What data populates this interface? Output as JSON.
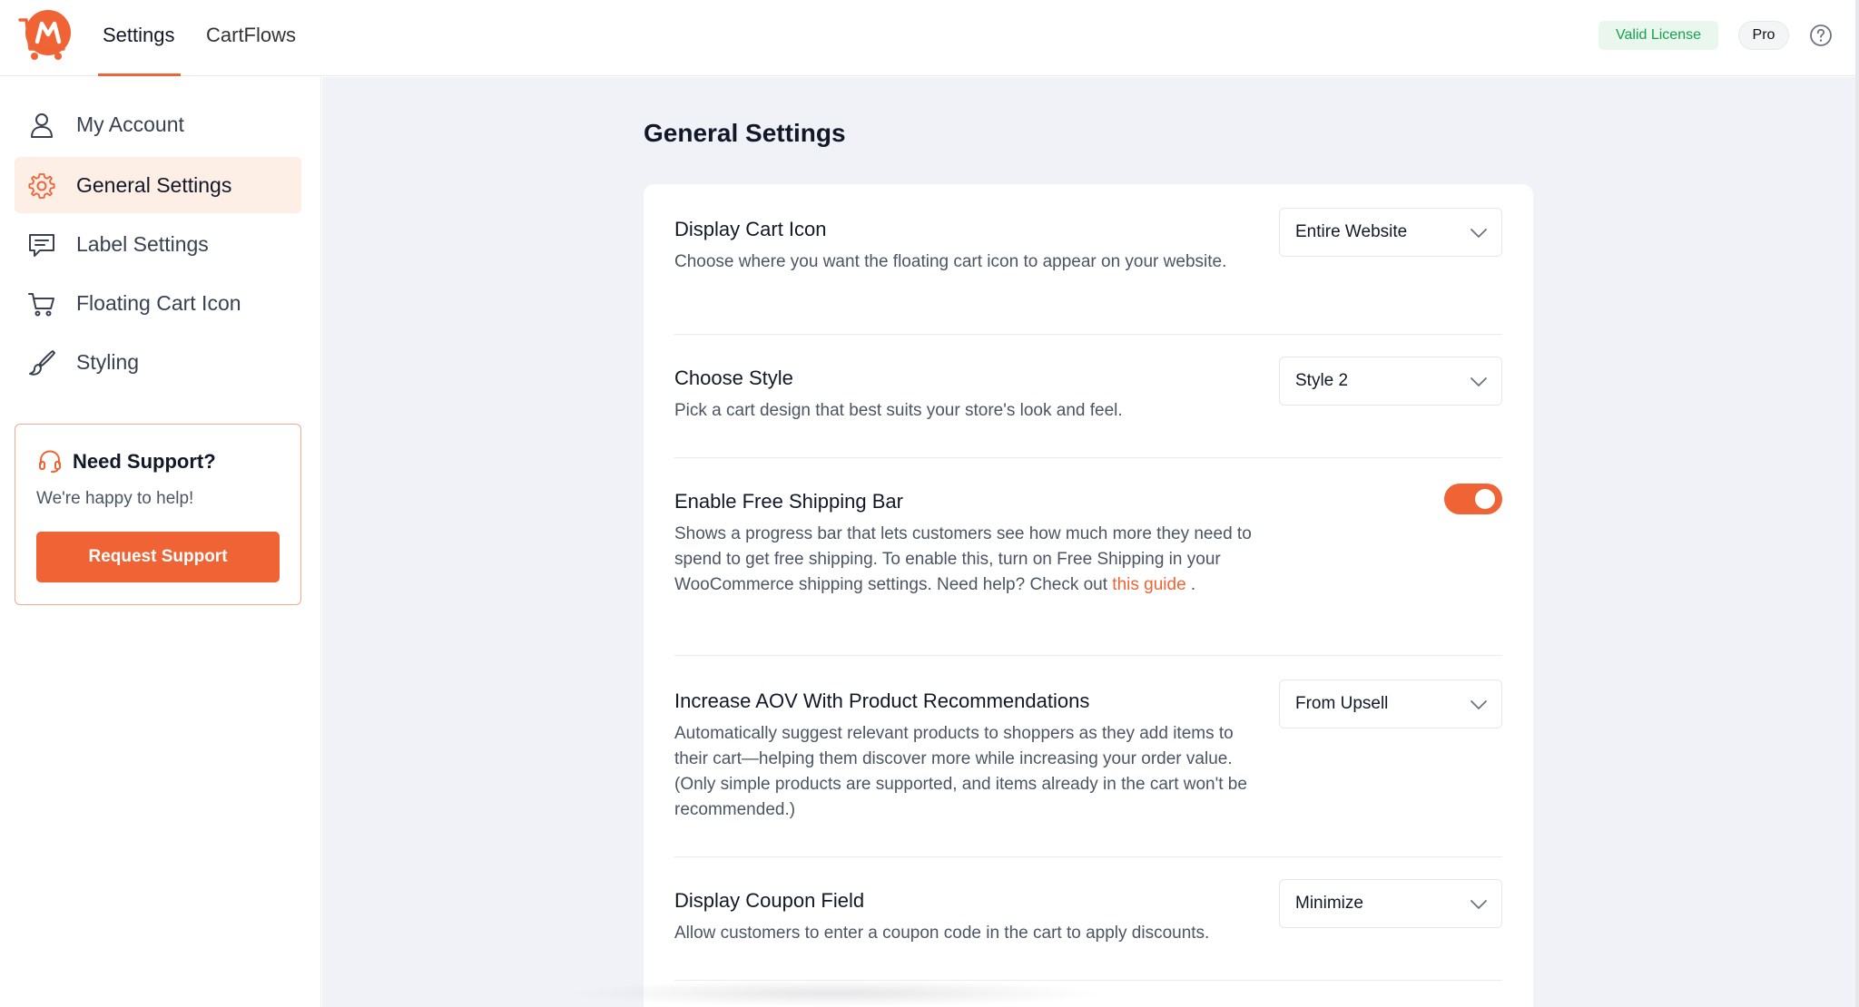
{
  "header": {
    "tabs": [
      {
        "label": "Settings",
        "active": true
      },
      {
        "label": "CartFlows",
        "active": false
      }
    ],
    "license_badge": "Valid License",
    "plan_badge": "Pro",
    "icons": {
      "logo": "cart-logo-icon",
      "help": "help-circle-icon"
    }
  },
  "sidebar": {
    "items": [
      {
        "label": "My Account",
        "icon": "user-icon",
        "active": false
      },
      {
        "label": "General Settings",
        "icon": "gear-icon",
        "active": true
      },
      {
        "label": "Label Settings",
        "icon": "message-icon",
        "active": false
      },
      {
        "label": "Floating Cart Icon",
        "icon": "cart-icon",
        "active": false
      },
      {
        "label": "Styling",
        "icon": "brush-icon",
        "active": false
      }
    ],
    "support": {
      "title": "Need Support?",
      "subtitle": "We're happy to help!",
      "button": "Request Support",
      "icon": "headset-icon"
    }
  },
  "main": {
    "title": "General Settings",
    "settings": [
      {
        "title": "Display Cart Icon",
        "description": "Choose where you want the floating cart icon to appear on your website.",
        "control": "select",
        "value": "Entire Website"
      },
      {
        "title": "Choose Style",
        "description": "Pick a cart design that best suits your store's look and feel.",
        "control": "select",
        "value": "Style 2"
      },
      {
        "title": "Enable Free Shipping Bar",
        "description_before": "Shows a progress bar that lets customers see how much more they need to spend to get free shipping. To enable this, turn on Free Shipping in your WooCommerce shipping settings. Need help? Check out ",
        "link": "this guide",
        "description_after": " .",
        "control": "toggle",
        "enabled": true
      },
      {
        "title": "Increase AOV With Product Recommendations",
        "description": "Automatically suggest relevant products to shoppers as they add items to their cart—helping them discover more while increasing your order value. (Only simple products are supported, and items already in the cart won't be recommended.)",
        "control": "select",
        "value": "From Upsell"
      },
      {
        "title": "Display Coupon Field",
        "description": "Allow customers to enter a coupon code in the cart to apply discounts.",
        "control": "select",
        "value": "Minimize"
      }
    ]
  },
  "colors": {
    "accent": "#f06335",
    "active_bg": "#fdeee6",
    "page_bg": "#f0f2f7",
    "valid_text": "#16a34a",
    "valid_bg": "#e9f7ee"
  }
}
